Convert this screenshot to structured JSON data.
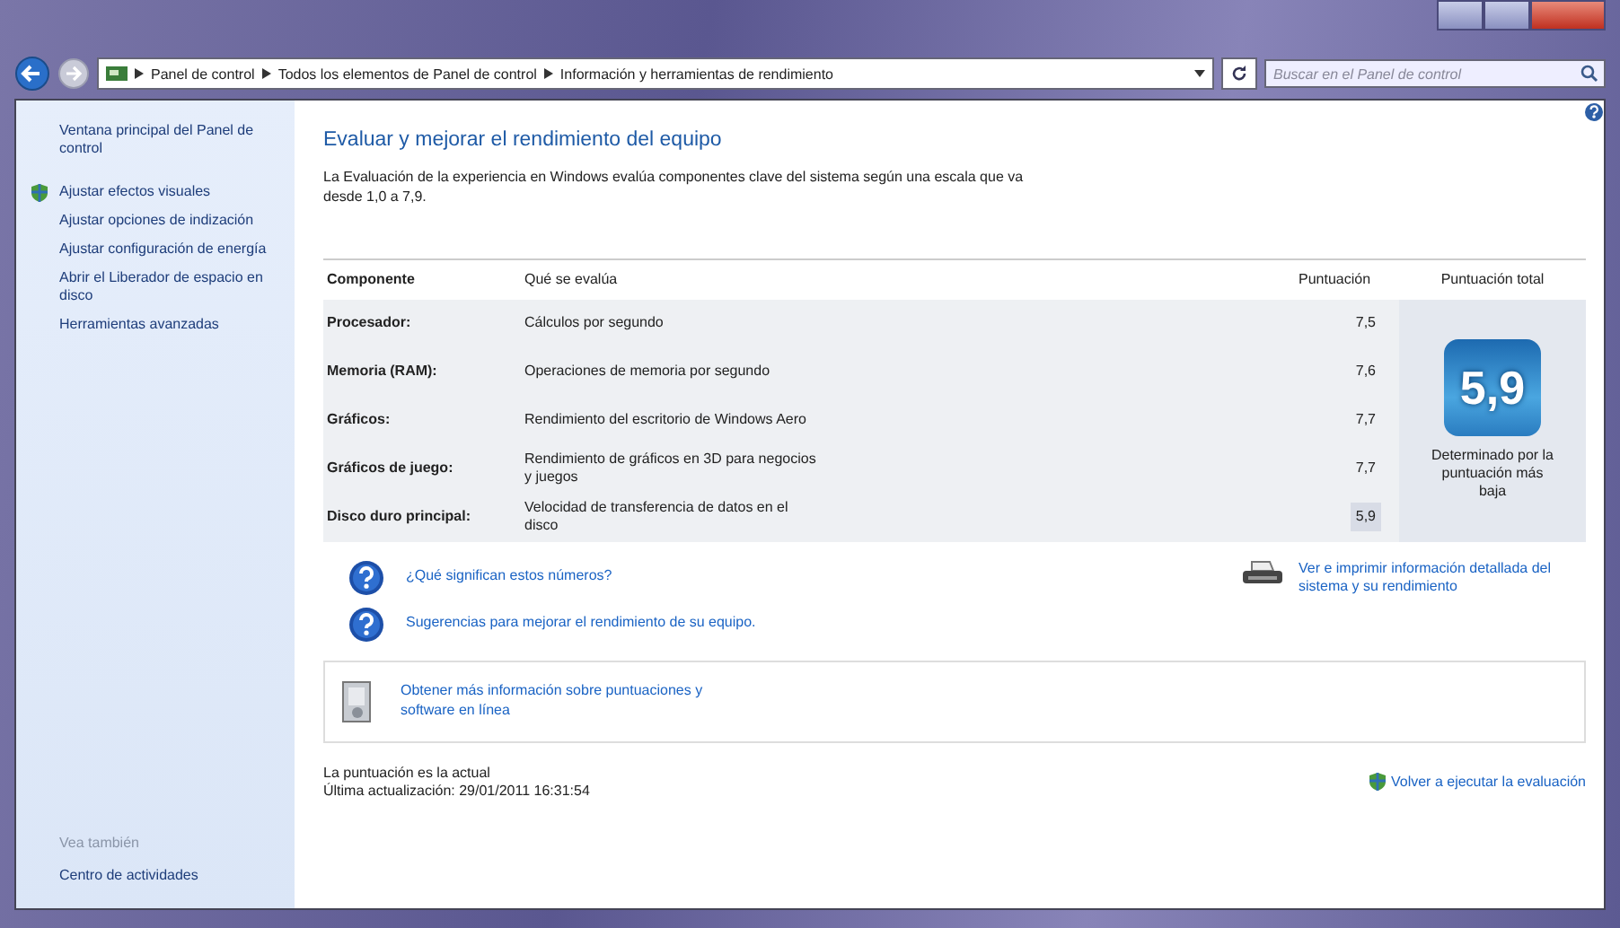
{
  "address_bar": {
    "breadcrumbs": [
      {
        "label": "Panel de control"
      },
      {
        "label": "Todos los elementos de Panel de control"
      },
      {
        "label": "Información y herramientas de rendimiento"
      }
    ],
    "search_placeholder": "Buscar en el Panel de control"
  },
  "sidebar": {
    "items": [
      {
        "label": "Ventana principal del Panel de control",
        "kind": "plain"
      },
      {
        "label": "Ajustar efectos visuales",
        "kind": "shield"
      },
      {
        "label": "Ajustar opciones de indización",
        "kind": "plain"
      },
      {
        "label": "Ajustar configuración de energía",
        "kind": "plain"
      },
      {
        "label": "Abrir el Liberador de espacio en disco",
        "kind": "plain"
      },
      {
        "label": "Herramientas avanzadas",
        "kind": "plain"
      }
    ],
    "see_also_heading": "Vea también",
    "see_also": [
      "Centro de actividades"
    ]
  },
  "main": {
    "title": "Evaluar y mejorar el rendimiento del equipo",
    "description": "La Evaluación de la experiencia en Windows evalúa componentes clave del sistema según una escala que va desde 1,0 a 7,9.",
    "table": {
      "columns": [
        "Componente",
        "Qué se evalúa",
        "Puntuación",
        "Puntuación total"
      ],
      "rows": [
        {
          "component": "Procesador:",
          "evaluates": "Cálculos por segundo",
          "score": "7,5",
          "lowest": false
        },
        {
          "component": "Memoria (RAM):",
          "evaluates": "Operaciones de memoria por segundo",
          "score": "7,6",
          "lowest": false
        },
        {
          "component": "Gráficos:",
          "evaluates": "Rendimiento del escritorio de Windows Aero",
          "score": "7,7",
          "lowest": false
        },
        {
          "component": "Gráficos de juego:",
          "evaluates": "Rendimiento de gráficos en 3D para negocios y juegos",
          "score": "7,7",
          "lowest": false
        },
        {
          "component": "Disco duro principal:",
          "evaluates": "Velocidad de transferencia de datos en el disco",
          "score": "5,9",
          "lowest": true
        }
      ],
      "total_score": "5,9",
      "total_caption": "Determinado por la puntuación más baja"
    },
    "help_links": [
      "¿Qué significan estos números?",
      "Sugerencias para mejorar el rendimiento de su equipo."
    ],
    "print_link": "Ver e imprimir información detallada del sistema y su rendimiento",
    "online_link": "Obtener más información sobre puntuaciones y software en línea",
    "status": "La puntuación es la actual",
    "last_update": "Última actualización: 29/01/2011 16:31:54",
    "rerun_link": "Volver a ejecutar la evaluación"
  }
}
